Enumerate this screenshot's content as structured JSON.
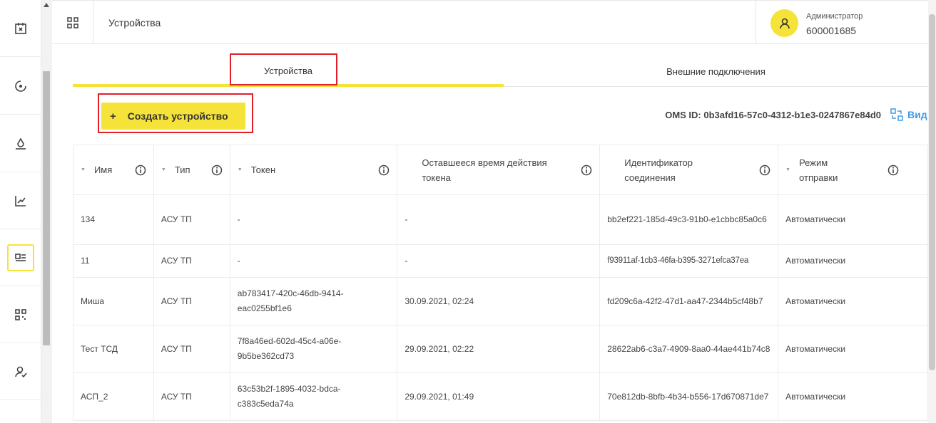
{
  "header": {
    "title": "Устройства"
  },
  "user": {
    "role": "Администратор",
    "id": "600001685"
  },
  "tabs": [
    {
      "label": "Устройства",
      "active": true
    },
    {
      "label": "Внешние подключения",
      "active": false
    }
  ],
  "toolbar": {
    "create_plus": "+",
    "create_label": "Создать устройство",
    "oms_id": "OMS ID: 0b3afd16-57c0-4312-b1e3-0247867e84d0",
    "view_label": "Вид"
  },
  "table": {
    "columns": [
      "Имя",
      "Тип",
      "Токен",
      "Оставшееся время действия токена",
      "Идентификатор соединения",
      "Режим отправки"
    ],
    "rows": [
      [
        "134",
        "АСУ ТП",
        "-",
        "-",
        "bb2ef221-185d-49c3-91b0-e1cbbc85a0c6",
        "Автоматически"
      ],
      [
        "11",
        "АСУ ТП",
        "-",
        "-",
        "f93911af-1cb3-46fa-b395-3271efca37ea",
        "Автоматически"
      ],
      [
        "Миша",
        "АСУ ТП",
        "ab783417-420c-46db-9414-eac0255bf1e6",
        "30.09.2021, 02:24",
        "fd209c6a-42f2-47d1-aa47-2344b5cf48b7",
        "Автоматически"
      ],
      [
        "Тест ТСД",
        "АСУ ТП",
        "7f8a46ed-602d-45c4-a06e-9b5be362cd73",
        "29.09.2021, 02:22",
        "28622ab6-c3a7-4909-8aa0-44ae441b74c8",
        "Автоматически"
      ],
      [
        "АСП_2",
        "АСУ ТП",
        "63c53b2f-1895-4032-bdca-c383c5eda74a",
        "29.09.2021, 01:49",
        "70e812db-8bfb-4b34-b556-17d670871de7",
        "Автоматически"
      ]
    ]
  },
  "colors": {
    "accent": "#f5e33a",
    "highlight": "#e21f26",
    "link": "#3d9be9"
  }
}
